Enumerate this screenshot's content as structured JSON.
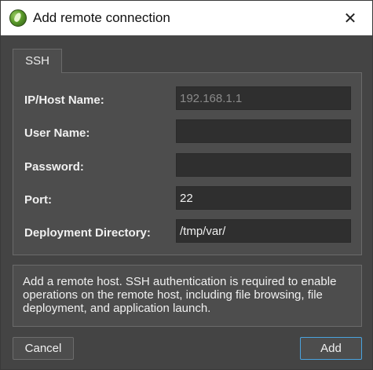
{
  "window": {
    "title": "Add remote connection",
    "close_glyph": "✕",
    "icon": "app-logo-icon"
  },
  "tabs": [
    {
      "label": "SSH",
      "selected": true
    }
  ],
  "form": {
    "host": {
      "label": "IP/Host Name:",
      "value": "",
      "placeholder": "192.168.1.1"
    },
    "user": {
      "label": "User Name:",
      "value": "",
      "placeholder": ""
    },
    "password": {
      "label": "Password:",
      "value": "",
      "placeholder": ""
    },
    "port": {
      "label": "Port:",
      "value": "22",
      "placeholder": ""
    },
    "deploy_dir": {
      "label": "Deployment Directory:",
      "value": "/tmp/var/",
      "placeholder": ""
    }
  },
  "info_text": "Add a remote host. SSH authentication is required to enable operations on the remote host, including file browsing, file deployment, and application launch.",
  "buttons": {
    "cancel": "Cancel",
    "add": "Add"
  },
  "colors": {
    "background": "#444444",
    "panel": "#4d4d4d",
    "field": "#2f2f2f",
    "accent_focus": "#4aa3df"
  }
}
